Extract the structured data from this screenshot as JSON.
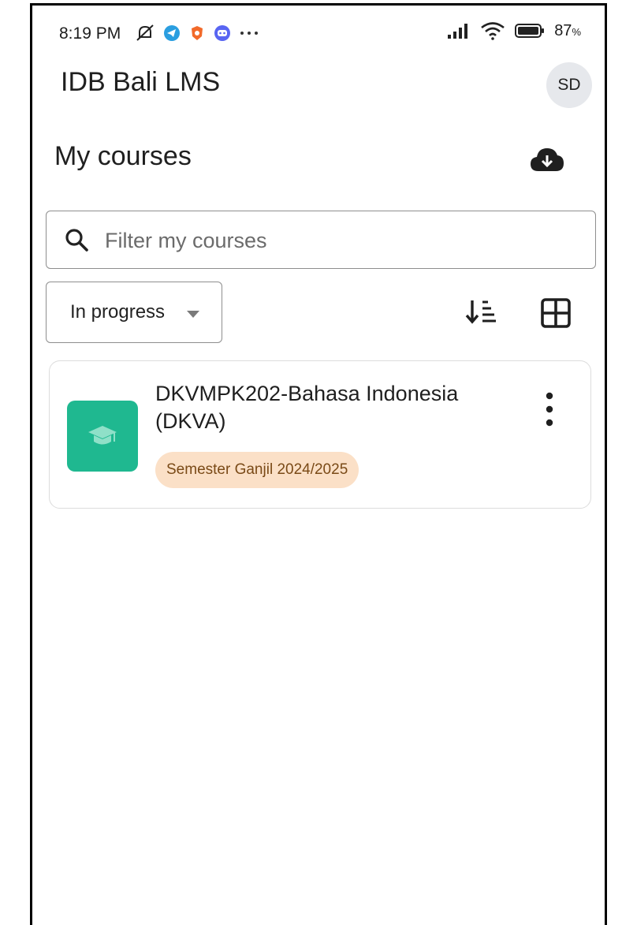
{
  "status_bar": {
    "time": "8:19 PM",
    "battery": "87",
    "battery_unit": "%"
  },
  "header": {
    "app_title": "IDB Bali LMS",
    "avatar_initials": "SD"
  },
  "page": {
    "title": "My courses"
  },
  "search": {
    "placeholder": "Filter my courses",
    "value": ""
  },
  "filter": {
    "selected": "In progress"
  },
  "courses": [
    {
      "name": "DKVMPK202-Bahasa Indonesia (DKVA)",
      "category": "Semester Ganjil 2024/2025"
    }
  ],
  "colors": {
    "course_image": "#1fb890",
    "badge_bg": "#fbe0c7",
    "badge_text": "#7a4a17"
  }
}
